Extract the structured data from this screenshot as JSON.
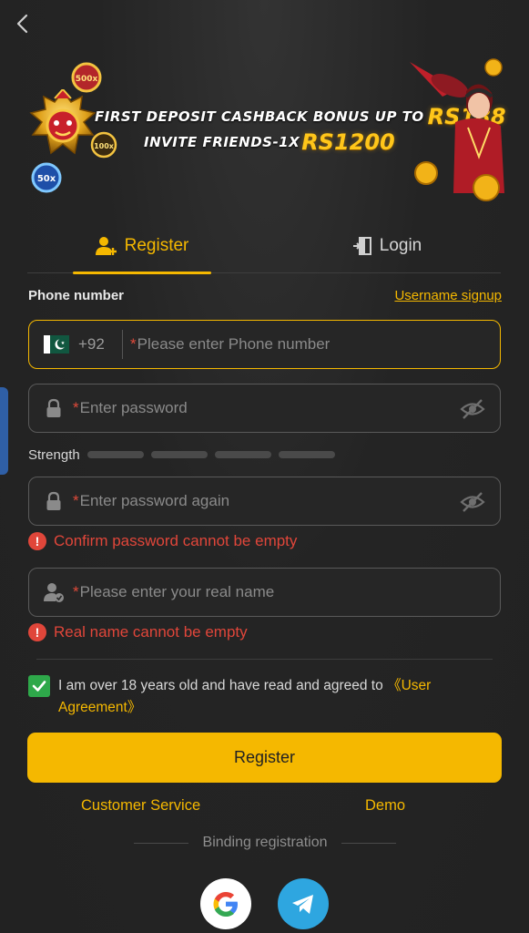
{
  "banner": {
    "line1_text": "FIRST DEPOSIT CASHBACK BONUS UP TO",
    "line1_amount": "RS188",
    "line2_text": "INVITE FRIENDS-1X",
    "line2_amount": "RS1200",
    "chip_labels": [
      "500x",
      "100x",
      "50x"
    ]
  },
  "tabs": [
    {
      "label": "Register",
      "active": true
    },
    {
      "label": "Login",
      "active": false
    }
  ],
  "form": {
    "phone_label": "Phone number",
    "username_signup": "Username signup",
    "country_code": "+92",
    "phone_placeholder": "Please enter Phone number",
    "password_placeholder": "Enter password",
    "strength_label": "Strength",
    "strength_level": 0,
    "confirm_placeholder": "Enter password again",
    "confirm_error": "Confirm password cannot be empty",
    "realname_placeholder": "Please enter your real name",
    "realname_error": "Real name cannot be empty",
    "required_mark": "*"
  },
  "agreement": {
    "checked": true,
    "text": "I am over 18 years old and have read and agreed to",
    "link": "《User Agreement》"
  },
  "buttons": {
    "register": "Register",
    "customer_service": "Customer Service",
    "demo": "Demo"
  },
  "binding": {
    "label": "Binding registration"
  },
  "colors": {
    "accent": "#f5b800",
    "error": "#e0463a",
    "checkbox": "#2ea84a",
    "telegram": "#2ea6e0"
  }
}
